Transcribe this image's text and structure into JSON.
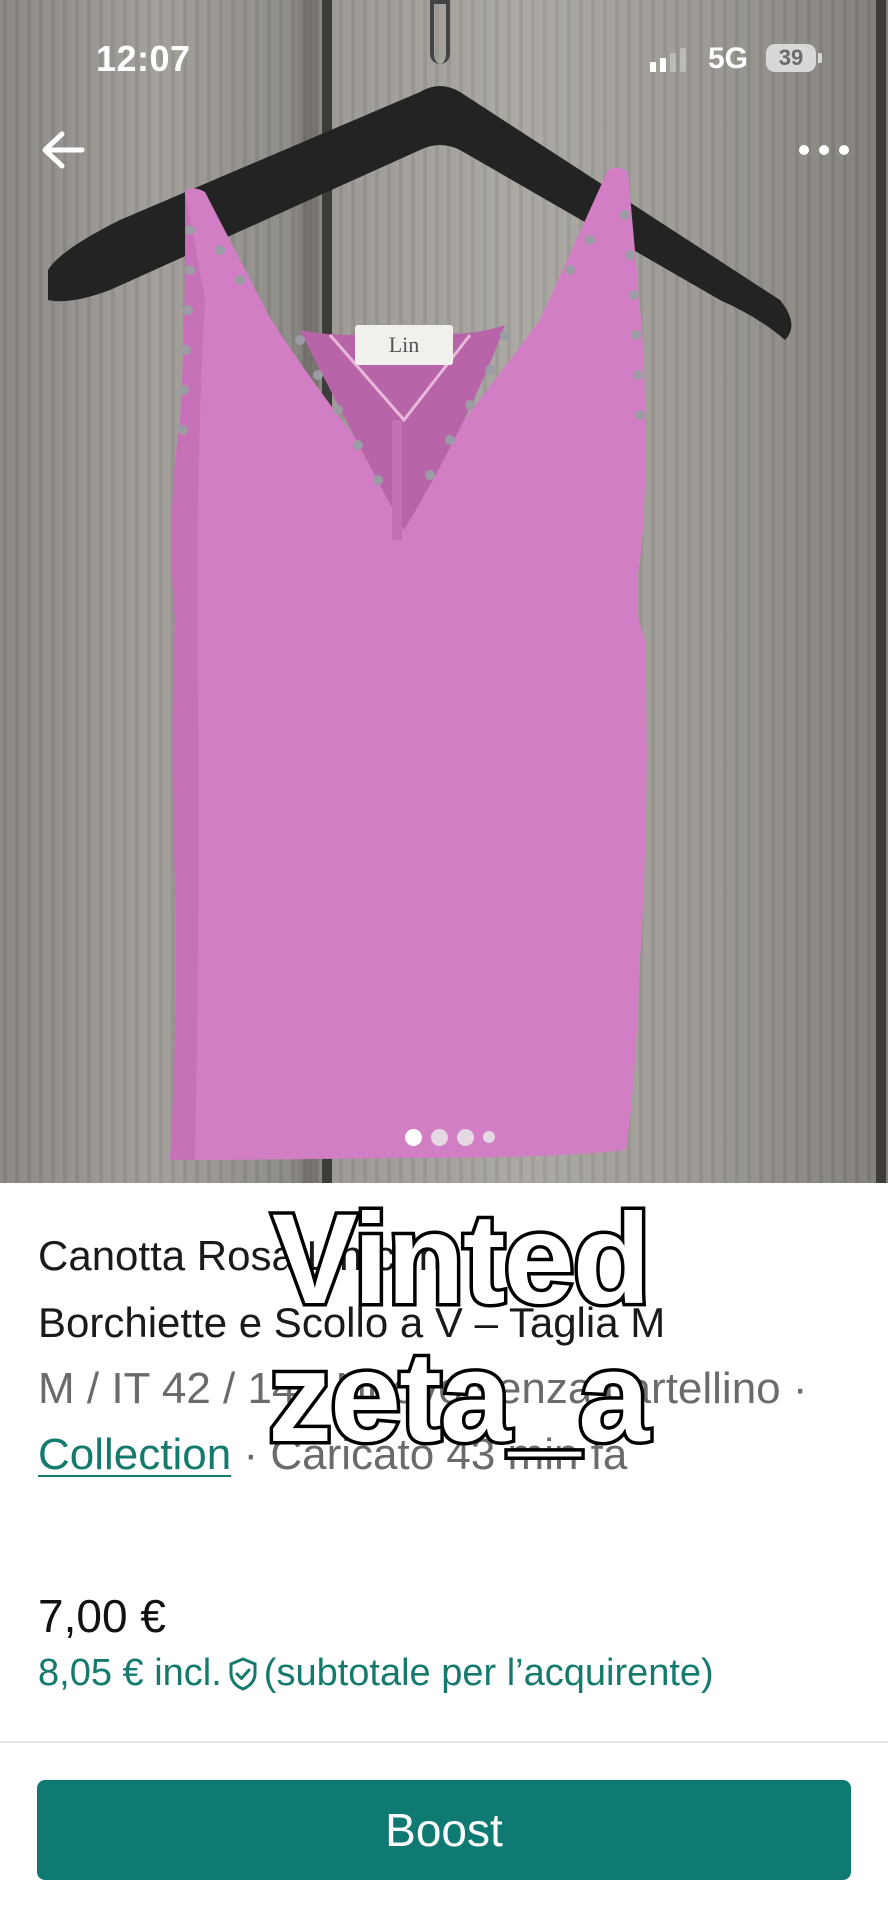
{
  "status_bar": {
    "time": "12:07",
    "network": "5G",
    "battery": "39"
  },
  "listing": {
    "title_line1": "Canotta Rosa Lin con",
    "title_line2": "Borchiette e Scollo a V – Taglia M",
    "meta_prefix": "M / IT 42 / 14 · Nuovo senza cartellino · ",
    "meta_link": "Collection",
    "meta_suffix": " · Caricato 43 min fa",
    "price": "7,00 €",
    "price_incl": "8,05 € incl.",
    "price_incl_note": "(subtotale per l’acquirente)"
  },
  "carousel": {
    "total": 4,
    "active": 1
  },
  "actions": {
    "boost_label": "Boost"
  },
  "watermark": {
    "line1": "Vinted",
    "line2": "zeta_a"
  },
  "colors": {
    "accent": "#0f7a71",
    "link": "#157a6e",
    "item": "#d97ac4"
  },
  "icons": [
    "back-arrow-icon",
    "more-dots-icon",
    "shield-icon",
    "signal-icon",
    "battery-icon"
  ]
}
